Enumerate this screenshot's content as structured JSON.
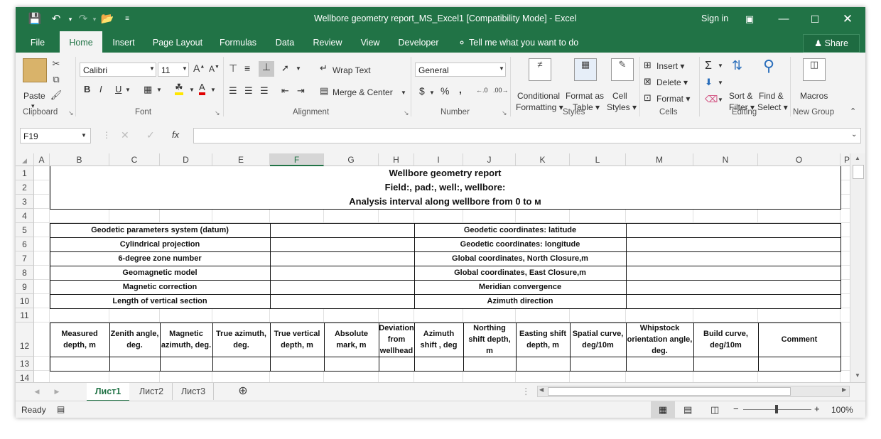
{
  "window": {
    "title": "Wellbore geometry report_MS_Excel1  [Compatibility Mode] - Excel",
    "sign_in": "Sign in"
  },
  "tabs": [
    "File",
    "Home",
    "Insert",
    "Page Layout",
    "Formulas",
    "Data",
    "Review",
    "View",
    "Developer"
  ],
  "tell_me": "Tell me what you want to do",
  "share": "Share",
  "ribbon": {
    "clipboard": {
      "paste": "Paste",
      "label": "Clipboard"
    },
    "font": {
      "name": "Calibri",
      "size": "11",
      "label": "Font"
    },
    "alignment": {
      "wrap": "Wrap Text",
      "merge": "Merge & Center",
      "label": "Alignment"
    },
    "number": {
      "format": "General",
      "label": "Number"
    },
    "styles": {
      "cond1": "Conditional",
      "cond2": "Formatting",
      "fmt1": "Format as",
      "fmt2": "Table",
      "cell1": "Cell",
      "cell2": "Styles",
      "label": "Styles"
    },
    "cells": {
      "insert": "Insert",
      "delete": "Delete",
      "format": "Format",
      "label": "Cells"
    },
    "editing": {
      "sort1": "Sort &",
      "sort2": "Filter",
      "find1": "Find &",
      "find2": "Select",
      "label": "Editing"
    },
    "newgroup": {
      "macros": "Macros",
      "label": "New Group"
    }
  },
  "formula_bar": {
    "name_box": "F19",
    "value": ""
  },
  "columns": [
    "A",
    "B",
    "C",
    "D",
    "E",
    "F",
    "G",
    "H",
    "I",
    "J",
    "K",
    "L",
    "M",
    "N",
    "O",
    "P"
  ],
  "rows": [
    "1",
    "2",
    "3",
    "4",
    "5",
    "6",
    "7",
    "8",
    "9",
    "10",
    "11",
    "12",
    "13",
    "14"
  ],
  "sheet": {
    "title": "Wellbore geometry report",
    "subtitle": "Field:, pad:, well:, wellbore:",
    "interval": "Analysis interval along wellbore from 0 to    м",
    "params_left": [
      "Geodetic parameters system (datum)",
      "Cylindrical projection",
      "6-degree zone number",
      "Geomagnetic model",
      "Magnetic correction",
      "Length of vertical section"
    ],
    "params_right": [
      "Geodetic coordinates: latitude",
      "Geodetic coordinates: longitude",
      "Global coordinates, North Closure,m",
      "Global coordinates, East Closure,m",
      "Meridian convergence",
      "Azimuth direction"
    ],
    "headers": [
      "Measured depth, m",
      "Zenith angle, deg.",
      "Magnetic azimuth, deg.",
      "True azimuth, deg.",
      "True vertical depth, m",
      "Absolute mark, m",
      "Deviation from wellhead",
      "Azimuth shift , deg",
      "Northing shift depth, m",
      "Easting shift depth, m",
      "Spatial curve, deg/10m",
      "Whipstock orientation angle, deg.",
      "Build curve, deg/10m",
      "Comment"
    ]
  },
  "sheet_tabs": [
    "Лист1",
    "Лист2",
    "Лист3"
  ],
  "status": {
    "ready": "Ready",
    "zoom": "100%"
  }
}
